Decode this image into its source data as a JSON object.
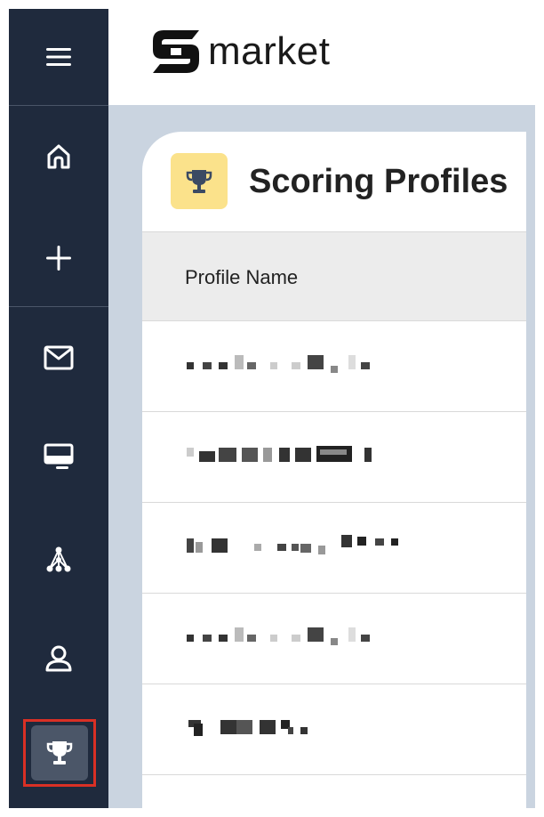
{
  "brand": {
    "name": "market"
  },
  "sidebar": {
    "items": [
      {
        "id": "menu",
        "icon": "hamburger-menu-icon"
      },
      {
        "id": "home",
        "icon": "home-icon"
      },
      {
        "id": "add",
        "icon": "plus-icon"
      },
      {
        "id": "mail",
        "icon": "mail-icon"
      },
      {
        "id": "display",
        "icon": "monitor-icon"
      },
      {
        "id": "network",
        "icon": "network-nodes-icon"
      },
      {
        "id": "user",
        "icon": "user-icon"
      },
      {
        "id": "scoring",
        "icon": "trophy-icon",
        "active": true
      }
    ]
  },
  "page": {
    "title": "Scoring Profiles",
    "icon": "trophy-icon"
  },
  "table": {
    "columns": [
      "Profile Name"
    ],
    "rows": [
      {
        "name": "[redacted]"
      },
      {
        "name": "[redacted]"
      },
      {
        "name": "[redacted]"
      },
      {
        "name": "[redacted]"
      },
      {
        "name": "[redacted]"
      }
    ]
  },
  "colors": {
    "sidebar": "#1f2a3d",
    "content_bg": "#cad4e0",
    "accent_icon_bg": "#fbe28b",
    "active_highlight": "#d93025"
  }
}
